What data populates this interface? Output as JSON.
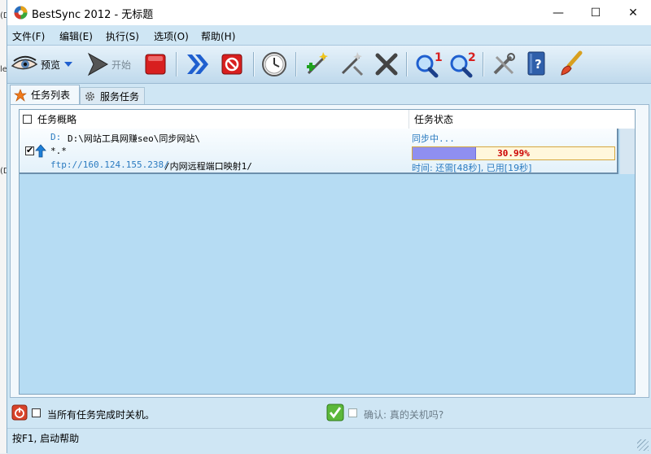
{
  "edge": {
    "t1": "(D",
    "t2": "le",
    "t3": "(D"
  },
  "window": {
    "title": "BestSync 2012 - 无标题"
  },
  "titlebar_buttons": {
    "minimize": "—",
    "maximize": "☐",
    "close": "✕"
  },
  "menu": [
    "文件(F)",
    "编辑(E)",
    "执行(S)",
    "选项(O)",
    "帮助(H)"
  ],
  "toolbar": {
    "preview_label": "预览",
    "start_label": "开始",
    "colors": {
      "stop": "#d81f1f",
      "accent": "#1f5fcf"
    }
  },
  "tabs": {
    "task_list": "任务列表",
    "service_tasks": "服务任务"
  },
  "listview": {
    "columns": {
      "summary": "任务概略",
      "status": "任务状态"
    },
    "rows": [
      {
        "local_prefix": "D:",
        "local_path": "D:\\网站工具网赚seo\\同步网站\\",
        "filter": "*.*",
        "remote_host": "ftp://160.124.155.238/",
        "remote_path": "/内网远程端口映射1/",
        "status": "同步中...",
        "progress_text": "30.99%",
        "progress": 0.3099,
        "time": "时间: 还需[48秒], 已用[19秒]"
      }
    ]
  },
  "bottom": {
    "shutdown_label": "当所有任务完成时关机。",
    "confirm_label": "确认: 真的关机吗?"
  },
  "status": {
    "text": "按F1, 启动帮助"
  }
}
